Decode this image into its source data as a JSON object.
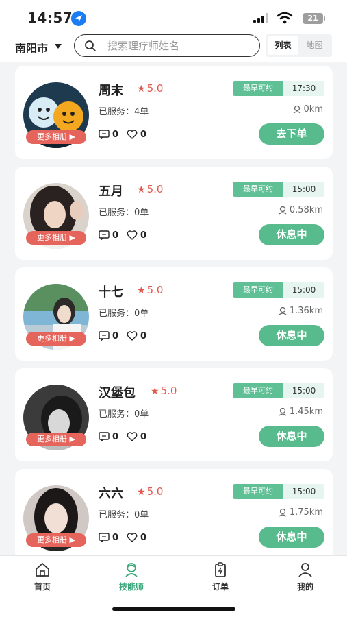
{
  "status_bar": {
    "time": "14:57",
    "battery": "21"
  },
  "header": {
    "city": "南阳市",
    "search": {
      "placeholder": "搜索理疗师姓名",
      "value": ""
    },
    "view_toggle": {
      "list": "列表",
      "map": "地图"
    }
  },
  "therapists": [
    {
      "name": "周末",
      "rating": "5.0",
      "served_label": "已服务：",
      "served": "4单",
      "earliest_label": "最早可约",
      "earliest_time": "17:30",
      "distance": "0km",
      "comments": "0",
      "likes": "0",
      "action": "去下单",
      "album": "更多相册"
    },
    {
      "name": "五月",
      "rating": "5.0",
      "served_label": "已服务：",
      "served": "0单",
      "earliest_label": "最早可约",
      "earliest_time": "15:00",
      "distance": "0.58km",
      "comments": "0",
      "likes": "0",
      "action": "休息中",
      "album": "更多相册"
    },
    {
      "name": "十七",
      "rating": "5.0",
      "served_label": "已服务：",
      "served": "0单",
      "earliest_label": "最早可约",
      "earliest_time": "15:00",
      "distance": "1.36km",
      "comments": "0",
      "likes": "0",
      "action": "休息中",
      "album": "更多相册"
    },
    {
      "name": "汉堡包",
      "rating": "5.0",
      "served_label": "已服务：",
      "served": "0单",
      "earliest_label": "最早可约",
      "earliest_time": "15:00",
      "distance": "1.45km",
      "comments": "0",
      "likes": "0",
      "action": "休息中",
      "album": "更多相册"
    },
    {
      "name": "六六",
      "rating": "5.0",
      "served_label": "已服务：",
      "served": "0单",
      "earliest_label": "最早可约",
      "earliest_time": "15:00",
      "distance": "1.75km",
      "comments": "0",
      "likes": "0",
      "action": "休息中",
      "album": "更多相册"
    }
  ],
  "tabs": [
    {
      "label": "首页",
      "icon": "home-icon",
      "active": false
    },
    {
      "label": "技能师",
      "icon": "therapist-icon",
      "active": true
    },
    {
      "label": "订单",
      "icon": "order-icon",
      "active": false
    },
    {
      "label": "我的",
      "icon": "profile-icon",
      "active": false
    }
  ],
  "colors": {
    "accent": "#58bb8d",
    "rating": "#e2574c",
    "album": "#e5655c",
    "active_tab": "#3aa77a"
  }
}
